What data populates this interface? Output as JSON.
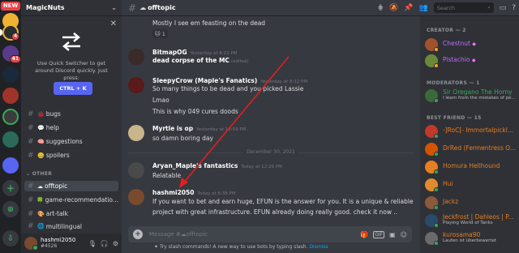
{
  "colors": {
    "accent": "#5865f2",
    "online": "#3ba55c",
    "idle": "#faa61a",
    "dnd": "#ed4245",
    "arrow": "#e02020",
    "creator_name": "#b96cff",
    "moderator_name": "#3ba55c",
    "best_friend_name": "#e67e22"
  },
  "rail": {
    "new_label": "NEW",
    "badges": [
      "4",
      "41"
    ]
  },
  "sidebar": {
    "server_name": "MagicNuts",
    "quick_switcher": {
      "text": "Use Quick Switcher to get around Discord quickly. Just press:",
      "shortcut": "CTRL + K",
      "icon": "arrows-swap-icon"
    },
    "channels_top": [
      {
        "name": "bugs",
        "emoji": "🐞"
      },
      {
        "name": "help",
        "emoji": "💬"
      },
      {
        "name": "suggestions",
        "emoji": "🧠"
      },
      {
        "name": "spoilers",
        "emoji": "🤐"
      }
    ],
    "category": "OTHER",
    "channels_other": [
      {
        "name": "offtopic",
        "emoji": "☁",
        "active": true
      },
      {
        "name": "game-recommendatio...",
        "emoji": "🍀"
      },
      {
        "name": "art-talk",
        "emoji": "🎨"
      },
      {
        "name": "multilingual",
        "emoji": "🌐"
      }
    ],
    "user": {
      "name": "hashmi2050",
      "tag": "#4526"
    }
  },
  "topbar": {
    "channel": "offtopic",
    "search_placeholder": "Search"
  },
  "messages": [
    {
      "text": "Mostly I see em feasting on  the dead",
      "reaction": {
        "emoji": "🐱",
        "count": "1"
      }
    },
    {
      "author": "BitmapOG",
      "time": "Yesterday at 8:11 PM",
      "lines": [
        "dead corpse of the MC"
      ],
      "edited": "(edited)"
    },
    {
      "author": "SleepyCrow (Maple's Fanatics)",
      "time": "Yesterday at 8:12 PM",
      "lines": [
        "So many things to be dead and you picked Lassie",
        "Lmao",
        "This is why 049 cures doods"
      ]
    },
    {
      "author": "Myrtle is op",
      "time": "Yesterday at 10:59 PM",
      "lines": [
        "so damn boring day"
      ]
    },
    {
      "author": "Aryan_Maple's fantastics",
      "time": "Today at 12:26 PM",
      "lines": [
        "Relatable"
      ]
    },
    {
      "author": "hashmi2050",
      "time": "Today at 8:38 PM",
      "lines": [
        "If you want to bet and earn huge, EFUN is the answer for you. It is a unique & reliable",
        "project with great  infrastructure. EFUN already doing really good. check it now .."
      ]
    }
  ],
  "date_divider": "December 30, 2021",
  "composer": {
    "placeholder": "Message #☁offtopic",
    "tip": "Try slash commands! A new way to use bots by typing slash.",
    "tip_link": "Dismiss"
  },
  "members": {
    "creator_header": "CREATOR — 2",
    "creators": [
      {
        "name": "Chestnut",
        "boost": "◆"
      },
      {
        "name": "Pistachio",
        "boost": "◆"
      }
    ],
    "moderator_header": "MODERATORS — 1",
    "moderators": [
      {
        "name": "Sir Oregano The Horny",
        "status": "I learn from the mistakes of pe..."
      }
    ],
    "best_friend_header": "BEST FRIEND — 15",
    "best_friends": [
      {
        "name": "-]RoC[- Immortalpickl..."
      },
      {
        "name": "DrRed (Fermentress O..."
      },
      {
        "name": "Homura Hellhound"
      },
      {
        "name": "Hui"
      },
      {
        "name": "Jackz"
      },
      {
        "name": "Jeckfrost | Dahleos | P...",
        "status": "Playing World of Tanks"
      },
      {
        "name": "kurosama90",
        "status": "Laufen ist überbewertet"
      }
    ]
  }
}
